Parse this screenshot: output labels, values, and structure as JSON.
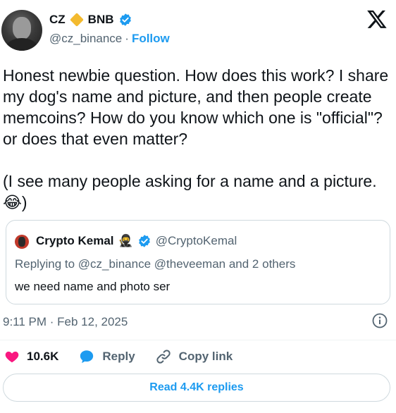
{
  "author": {
    "name": "CZ",
    "name_suffix": "BNB",
    "handle": "@cz_binance",
    "separator": "·",
    "follow_label": "Follow"
  },
  "tweet": {
    "text": "Honest newbie question. How does this work? I share my dog's name and picture, and then people create memcoins? How do you know which one is \"official\"? or does that even matter?\n\n(I see many people asking for a name and a picture. 😂)"
  },
  "quote": {
    "name": "Crypto Kemal",
    "emoji": "🥷",
    "handle": "@CryptoKemal",
    "replying_to": "Replying to @cz_binance @theveeman and 2 others",
    "text": "we need name and photo ser"
  },
  "meta": {
    "timestamp": "9:11 PM · Feb 12, 2025"
  },
  "actions": {
    "likes": "10.6K",
    "reply_label": "Reply",
    "copy_label": "Copy link"
  },
  "replies_button": "Read 4.4K replies",
  "colors": {
    "accent": "#1d9bf0",
    "like": "#f91880",
    "bnb": "#f3ba2f",
    "muted": "#536471"
  },
  "icons": [
    "x-logo-icon",
    "verified-icon",
    "bnb-diamond-icon",
    "info-icon",
    "heart-icon",
    "reply-bubble-icon",
    "link-icon"
  ]
}
